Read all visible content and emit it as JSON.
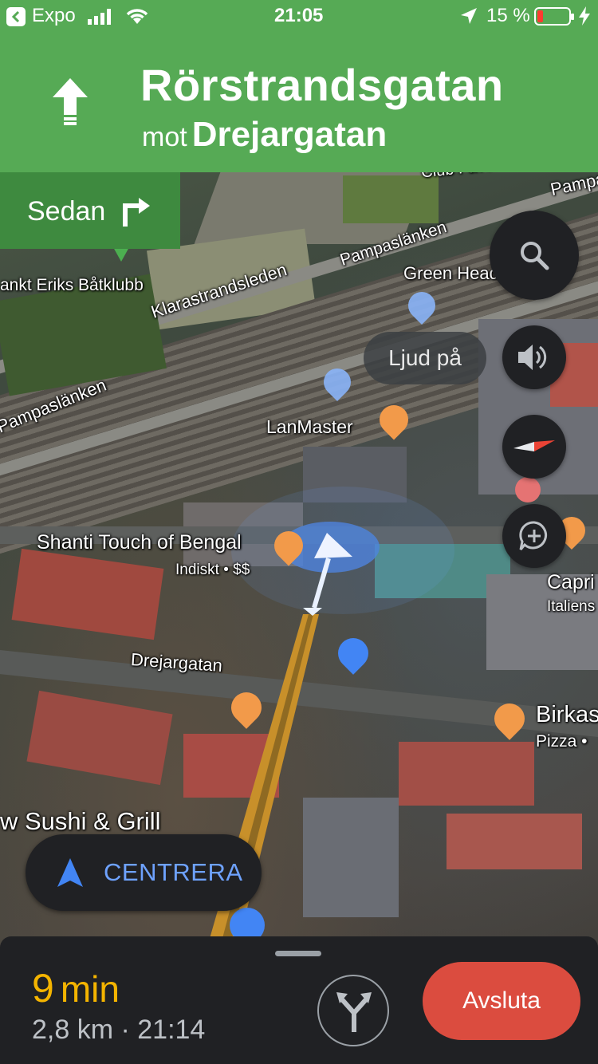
{
  "status_bar": {
    "back_app": "Expo",
    "time": "21:05",
    "battery_percent": "15 %"
  },
  "navigation": {
    "street": "Rörstrandsgatan",
    "toward_prefix": "mot",
    "toward_street": "Drejargatan",
    "then_label": "Sedan",
    "then_maneuver_icon": "turn-right-icon",
    "main_maneuver_icon": "straight-arrow-icon"
  },
  "map": {
    "labels": {
      "club_favela": "Club Favela",
      "pampa_top": "Pampa",
      "pampaslanken_1": "Pampaslänken",
      "pampaslanken_2": "Pampaslänken",
      "green_head": "Green Head",
      "sankt_eriks": "ankt Eriks Båtklubb",
      "klarastrandsleden": "Klarastrandsleden",
      "lanmaster": "LanMaster",
      "shanti": "Shanti Touch of Bengal",
      "shanti_sub": "Indiskt • $$",
      "capri": "Capri",
      "capri_sub": "Italiens",
      "drejargatan": "Drejargatan",
      "birkas": "Birkas",
      "birkas_sub": "Pizza •",
      "sushi": "w Sushi & Grill"
    }
  },
  "controls": {
    "sound_label": "Ljud på",
    "recenter_label": "CENTRERA"
  },
  "trip": {
    "eta_value": "9",
    "eta_unit": "min",
    "info": "2,8 km · 21:14",
    "end_label": "Avsluta"
  },
  "colors": {
    "nav_green": "#56aa55",
    "then_green": "#3e8a3f",
    "eta_yellow": "#f4b400",
    "end_red": "#db4c3f",
    "recenter_blue": "#6ea2ff",
    "route_orange": "#c8902a"
  }
}
